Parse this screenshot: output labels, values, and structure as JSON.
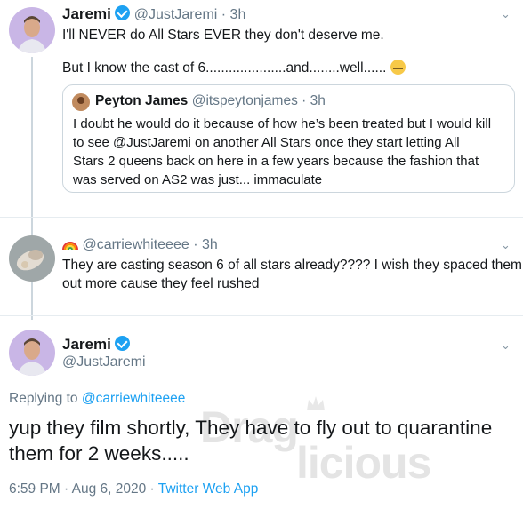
{
  "tweet1": {
    "name": "Jaremi",
    "handle_time": "@JustJaremi · 3h",
    "line1": "I'll NEVER do All Stars EVER they don't deserve me.",
    "line2": "But I know the cast of 6.....................and........well......",
    "emoji": "zipper-mouth-face-icon",
    "quote": {
      "name": "Peyton James",
      "handle_time": "@itspeytonjames · 3h",
      "lines": [
        "I doubt he would do it because of how he’s been treated but I would kill",
        "to see @JustJaremi on another All Stars once they start letting All",
        "Stars 2 queens back on here in a few years because the fashion that",
        "was served on AS2 was just... immaculate"
      ]
    }
  },
  "tweet2": {
    "name_emoji": "rainbow-icon",
    "handle_time": "@carriewhiteeee · 3h",
    "lines": [
      "They are casting season 6 of all stars already???? I wish they spaced them",
      "out more cause they feel rushed"
    ]
  },
  "tweet3": {
    "name": "Jaremi",
    "handle": "@JustJaremi",
    "replying_prefix": "Replying to ",
    "replying_handle": "@carriewhiteeee",
    "lines": [
      "yup they film shortly, They have to fly out to quarantine",
      "them for 2 weeks....."
    ],
    "timestamp": "6:59 PM · Aug 6, 2020 · ",
    "source": "Twitter Web App"
  },
  "watermark": {
    "text_top": "Drag",
    "text_bottom": "licious"
  },
  "colors": {
    "accent": "#1da1f2",
    "muted": "#657786",
    "border": "#ccd6dd"
  }
}
